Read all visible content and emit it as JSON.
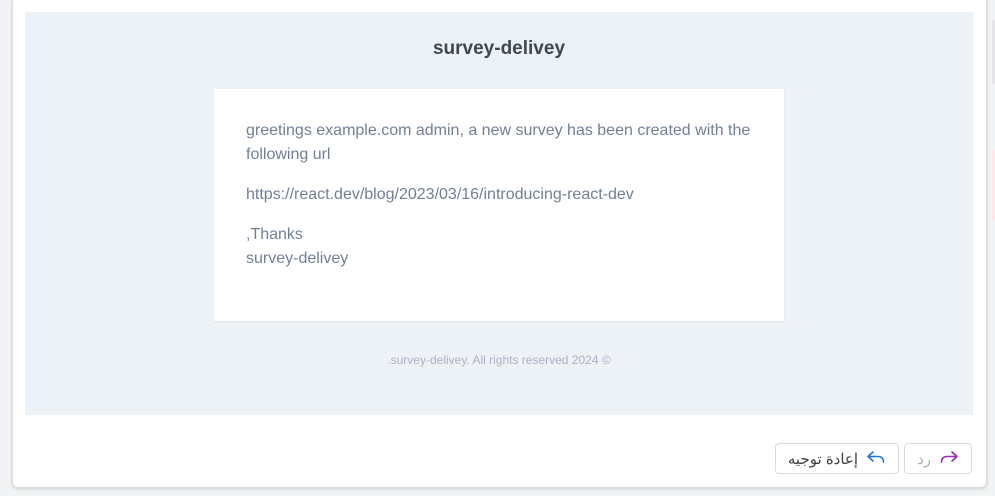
{
  "email": {
    "title": "survey-delivey",
    "greeting": "greetings example.com admin, a new survey has been created with the following url",
    "url": "https://react.dev/blog/2023/03/16/introducing-react-dev",
    "thanks": ",Thanks",
    "signature": "survey-delivey",
    "footer": ".survey-delivey. All rights reserved 2024 ©"
  },
  "actions": {
    "forward_label": "إعادة توجيه",
    "reply_label": "رد",
    "forward_icon": "reply-arrow-icon",
    "reply_icon": "forward-arrow-icon",
    "accent": "#1a73e8",
    "reply_icon_color": "#9c27b0"
  }
}
